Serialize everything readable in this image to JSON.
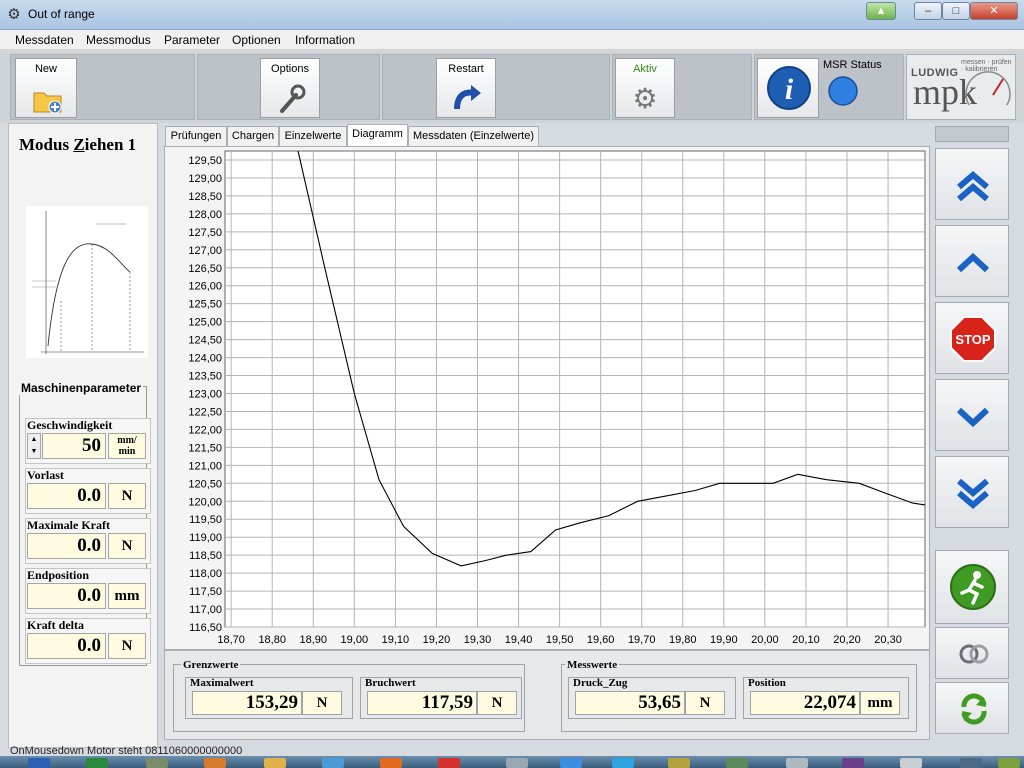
{
  "window": {
    "title": "Out of range"
  },
  "menu": [
    "Messdaten",
    "Messmodus",
    "Parameter",
    "Optionen",
    "Information"
  ],
  "toolbar": {
    "new_label": "New",
    "options_label": "Options",
    "restart_label": "Restart",
    "aktiv_label": "Aktiv",
    "msr_status_label": "MSR Status",
    "logo_brand": "LUDWIG",
    "logo_name": "mpk",
    "logo_tagline": "messen · prüfen · kalibrieren"
  },
  "left": {
    "mode_title_pre": "Modus ",
    "mode_title_ul": "Z",
    "mode_title_post": "iehen 1",
    "group_title": "Maschinenparameter",
    "params": [
      {
        "label": "Geschwindigkeit",
        "value": "50",
        "unit": "mm/ min"
      },
      {
        "label": "Vorlast",
        "value": "0.0",
        "unit": "N"
      },
      {
        "label": "Maximale Kraft",
        "value": "0.0",
        "unit": "N"
      },
      {
        "label": "Endposition",
        "value": "0.0",
        "unit": "mm"
      },
      {
        "label": "Kraft delta",
        "value": "0.0",
        "unit": "N"
      }
    ]
  },
  "tabs": [
    "Prüfungen",
    "Chargen",
    "Einzelwerte",
    "Diagramm",
    "Messdaten (Einzelwerte)"
  ],
  "active_tab": 3,
  "chart_data": {
    "type": "line",
    "y_ticks": [
      "129,50",
      "129,00",
      "128,50",
      "128,00",
      "127,50",
      "127,00",
      "126,50",
      "126,00",
      "125,50",
      "125,00",
      "124,50",
      "124,00",
      "123,50",
      "123,00",
      "122,50",
      "122,00",
      "121,50",
      "121,00",
      "120,50",
      "120,00",
      "119,50",
      "119,00",
      "118,50",
      "118,00",
      "117,50",
      "117,00",
      "116,50"
    ],
    "x_ticks": [
      "18,70",
      "18,80",
      "18,90",
      "19,00",
      "19,10",
      "19,20",
      "19,30",
      "19,40",
      "19,50",
      "19,60",
      "19,70",
      "19,80",
      "19,90",
      "20,00",
      "20,10",
      "20,20",
      "20,30"
    ],
    "xlim": [
      18.685,
      20.39
    ],
    "ylim": [
      116.5,
      129.75
    ],
    "grid": true,
    "series": [
      {
        "x": [
          18.86,
          18.93,
          19.0,
          19.06,
          19.12,
          19.19,
          19.26,
          19.32,
          19.37,
          19.43,
          19.49,
          19.55,
          19.62,
          19.69,
          19.76,
          19.83,
          19.89,
          19.95,
          20.02,
          20.08,
          20.15,
          20.23,
          20.3,
          20.36,
          20.39
        ],
        "y": [
          129.9,
          126.4,
          123.0,
          120.6,
          119.3,
          118.55,
          118.2,
          118.35,
          118.5,
          118.6,
          119.2,
          119.4,
          119.6,
          120.0,
          120.15,
          120.3,
          120.5,
          120.5,
          120.5,
          120.75,
          120.6,
          120.5,
          120.2,
          119.95,
          119.9
        ]
      }
    ]
  },
  "grenzwerte": {
    "title": "Grenzwerte",
    "maximalwert": {
      "label": "Maximalwert",
      "value": "153,29",
      "unit": "N"
    },
    "bruchwert": {
      "label": "Bruchwert",
      "value": "117,59",
      "unit": "N"
    }
  },
  "messwerte": {
    "title": "Messwerte",
    "druck_zug": {
      "label": "Druck_Zug",
      "value": "53,65",
      "unit": "N"
    },
    "position": {
      "label": "Position",
      "value": "22,074",
      "unit": "mm"
    }
  },
  "right_buttons": [
    "double-up",
    "up",
    "stop",
    "down",
    "double-down",
    "run",
    "link",
    "refresh"
  ],
  "stop_label": "STOP",
  "status_text": "OnMousedown Motor steht 0811060000000000",
  "colors": {
    "stop": "#d8231b",
    "run": "#3f9b24",
    "info": "#1f5fb3",
    "arrow": "#1a62c4",
    "input_bg": "#fffbe0"
  }
}
